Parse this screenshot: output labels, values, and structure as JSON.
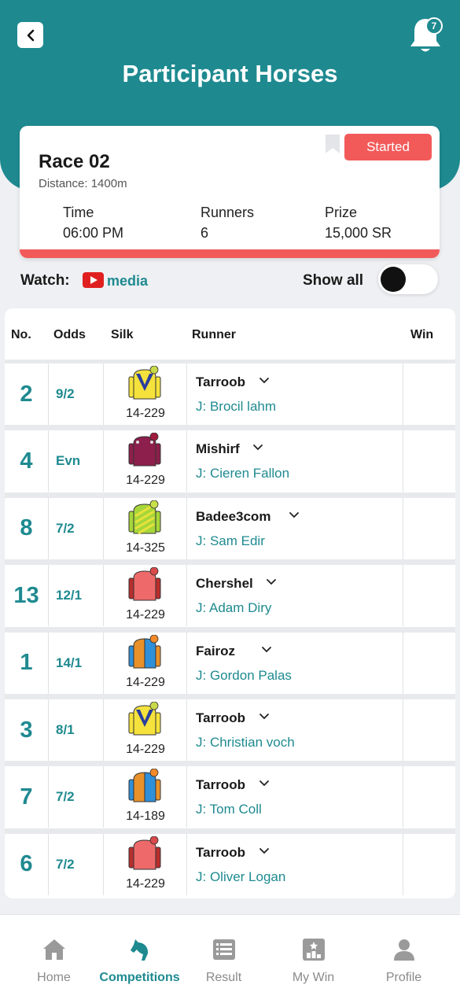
{
  "header": {
    "title": "Participant Horses",
    "notification_count": "7"
  },
  "race": {
    "name": "Race 02",
    "distance": "Distance: 1400m",
    "status": "Started",
    "stats": [
      {
        "label": "Time",
        "value": "06:00 PM"
      },
      {
        "label": "Runners",
        "value": "6"
      },
      {
        "label": "Prize",
        "value": "15,000 SR"
      }
    ]
  },
  "watch": {
    "label": "Watch:",
    "link": "media"
  },
  "show_all": {
    "label": "Show all",
    "on": false
  },
  "table": {
    "columns": [
      "No.",
      "Odds",
      "Silk",
      "Runner",
      "Win"
    ],
    "rows": [
      {
        "no": "2",
        "odds": "9/2",
        "silk_code": "14-229",
        "silk": "yellow-v",
        "horse": "Tarroob",
        "jockey": "J: Brocil lahm"
      },
      {
        "no": "4",
        "odds": "Evn",
        "silk_code": "14-229",
        "silk": "maroon",
        "horse": "Mishirf",
        "jockey": "J: Cieren Fallon"
      },
      {
        "no": "8",
        "odds": "7/2",
        "silk_code": "14-325",
        "silk": "green-stripes",
        "horse": "Badee3com",
        "jockey": "J: Sam Edir"
      },
      {
        "no": "13",
        "odds": "12/1",
        "silk_code": "14-229",
        "silk": "salmon",
        "horse": "Chershel",
        "jockey": "J: Adam Diry"
      },
      {
        "no": "1",
        "odds": "14/1",
        "silk_code": "14-229",
        "silk": "orange-blue",
        "horse": "Fairoz",
        "jockey": "J: Gordon Palas"
      },
      {
        "no": "3",
        "odds": "8/1",
        "silk_code": "14-229",
        "silk": "yellow-v",
        "horse": "Tarroob",
        "jockey": "J: Christian voch"
      },
      {
        "no": "7",
        "odds": "7/2",
        "silk_code": "14-189",
        "silk": "orange-blue",
        "horse": "Tarroob",
        "jockey": "J: Tom Coll"
      },
      {
        "no": "6",
        "odds": "7/2",
        "silk_code": "14-229",
        "silk": "salmon",
        "horse": "Tarroob",
        "jockey": "J: Oliver Logan"
      }
    ]
  },
  "nav": [
    {
      "label": "Home",
      "icon": "home-icon",
      "active": false
    },
    {
      "label": "Competitions",
      "icon": "horse-icon",
      "active": true
    },
    {
      "label": "Result",
      "icon": "list-icon",
      "active": false
    },
    {
      "label": "My Win",
      "icon": "podium-icon",
      "active": false
    },
    {
      "label": "Profile",
      "icon": "user-icon",
      "active": false
    }
  ],
  "colors": {
    "primary": "#1e8a90",
    "accent": "#f25a5a"
  }
}
